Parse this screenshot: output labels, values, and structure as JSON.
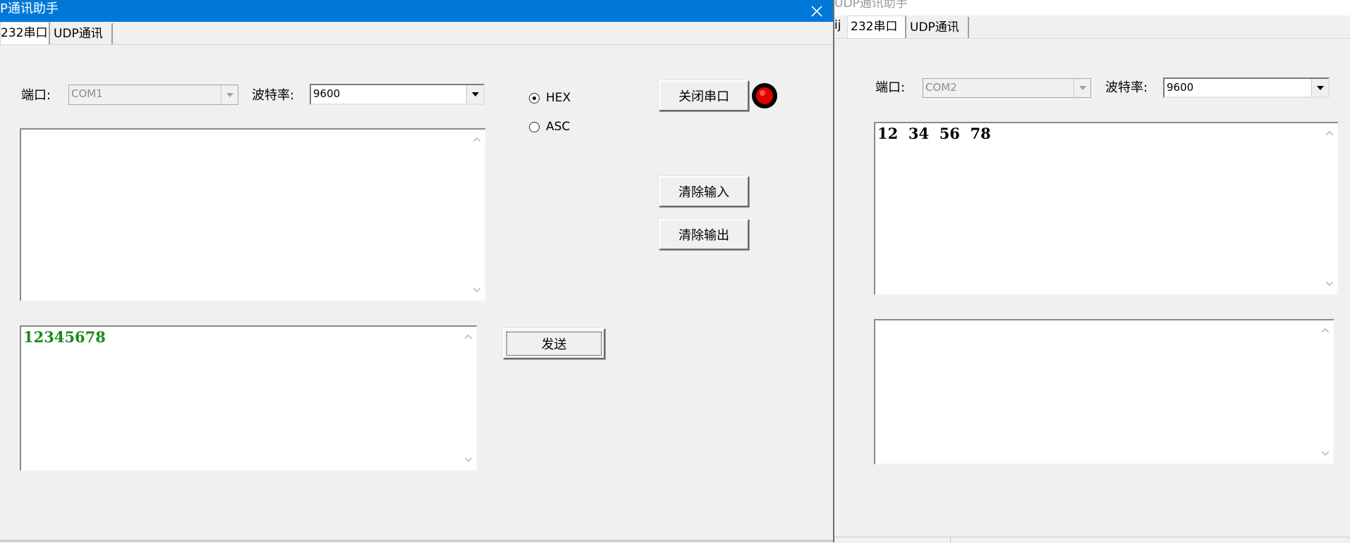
{
  "background_window": {
    "title": "UDP通讯助手",
    "tabs": [
      {
        "label": "232串口",
        "active": true
      },
      {
        "label": "UDP通讯",
        "active": false
      }
    ],
    "left_edge_fragment": "ij",
    "port_label": "端口:",
    "port_value": "COM2",
    "baud_label": "波特率:",
    "baud_value": "9600",
    "receive_text": "12  34  56  78",
    "send_text": ""
  },
  "main_window": {
    "title": "P通讯助手",
    "tabs": [
      {
        "label": "232串口",
        "active": true
      },
      {
        "label": "UDP通讯",
        "active": false
      }
    ],
    "port_label": "端口:",
    "port_value": "COM1",
    "baud_label": "波特率:",
    "baud_value": "9600",
    "format_options": [
      {
        "label": "HEX",
        "selected": true
      },
      {
        "label": "ASC",
        "selected": false
      }
    ],
    "close_port_label": "关闭串口",
    "port_status_color": "#e00000",
    "clear_input_label": "清除输入",
    "clear_output_label": "清除输出",
    "receive_text": "",
    "send_text": "12345678",
    "send_text_color": "#1a8a1a",
    "send_label": "发送"
  },
  "colors": {
    "titlebar_active": "#0078d7",
    "dialog_bg": "#f0f0f0"
  }
}
